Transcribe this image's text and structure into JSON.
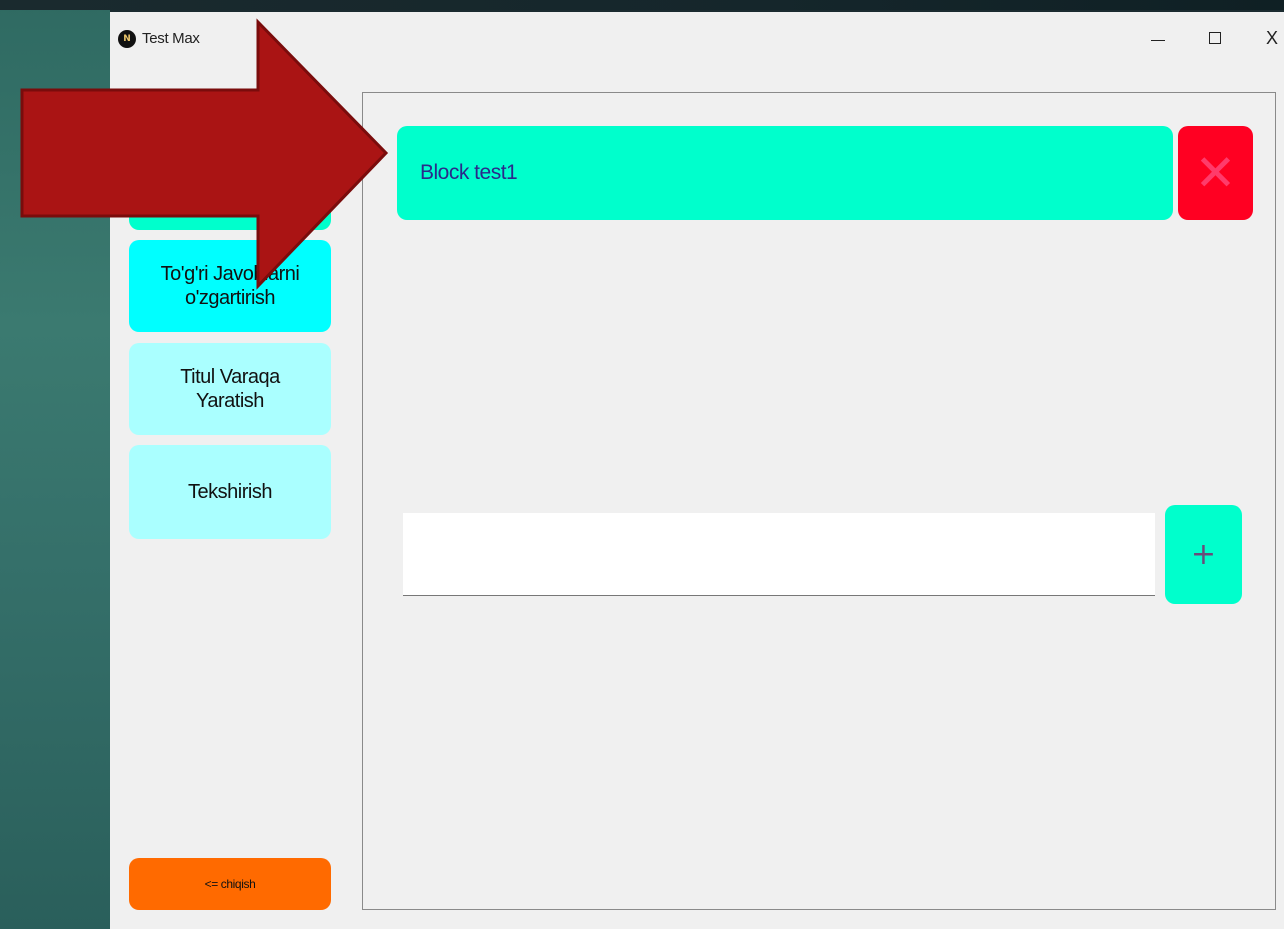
{
  "window": {
    "title": "Test Max",
    "icon_glyph": "N",
    "controls": {
      "minimize": "minimize-icon",
      "maximize": "maximize-icon",
      "close_label": "X"
    }
  },
  "sidebar": {
    "items": [
      {
        "label": ""
      },
      {
        "label": "To'g'ri Javoblarni\no'zgartirish"
      },
      {
        "label": "Titul Varaqa\nYaratish"
      },
      {
        "label": "Tekshirish"
      }
    ],
    "exit_label": "<= chiqish"
  },
  "main": {
    "blocks": [
      {
        "label": "Block test1",
        "delete_icon": "close-icon",
        "delete_glyph": "✕"
      }
    ],
    "new_block_input": {
      "value": "",
      "placeholder": ""
    },
    "add_label": "+"
  },
  "annotation": {
    "type": "arrow",
    "color": "#aa1414",
    "icon": "arrow-right-icon"
  },
  "colors": {
    "accent": "#00ffcc",
    "cyan": "#00ffff",
    "light_cyan": "#aaffff",
    "danger": "#ff0022",
    "exit": "#ff6a00",
    "annotation_arrow": "#aa1414"
  }
}
